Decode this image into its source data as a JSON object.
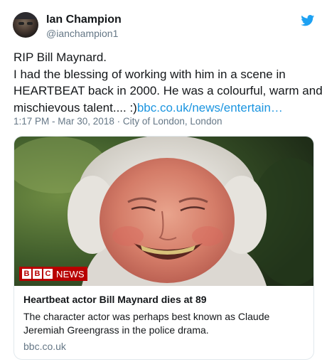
{
  "author": {
    "name": "Ian Champion",
    "handle": "@ianchampion1",
    "avatar_icon": "profile-photo"
  },
  "platform_icon": "twitter-bird-icon",
  "accent_color": "#1da1f2",
  "tweet": {
    "lines": [
      "RIP Bill Maynard.",
      " I had the blessing of working with him in a scene in",
      "HEARTBEAT back in 2000. He was a colourful, warm and",
      "mischievous talent.... :)"
    ],
    "link_text": "bbc.co.uk/news/entertain…"
  },
  "meta": {
    "time": "1:17 PM - Mar 30, 2018",
    "separator": "·",
    "location": "City of London, London"
  },
  "card": {
    "logo": {
      "blocks": [
        "B",
        "B",
        "C"
      ],
      "label": "NEWS"
    },
    "title": "Heartbeat actor Bill Maynard dies at 89",
    "description_lines": [
      "The character actor was perhaps best known as Claude",
      "Jeremiah Greengrass in the police drama."
    ],
    "domain": "bbc.co.uk"
  }
}
